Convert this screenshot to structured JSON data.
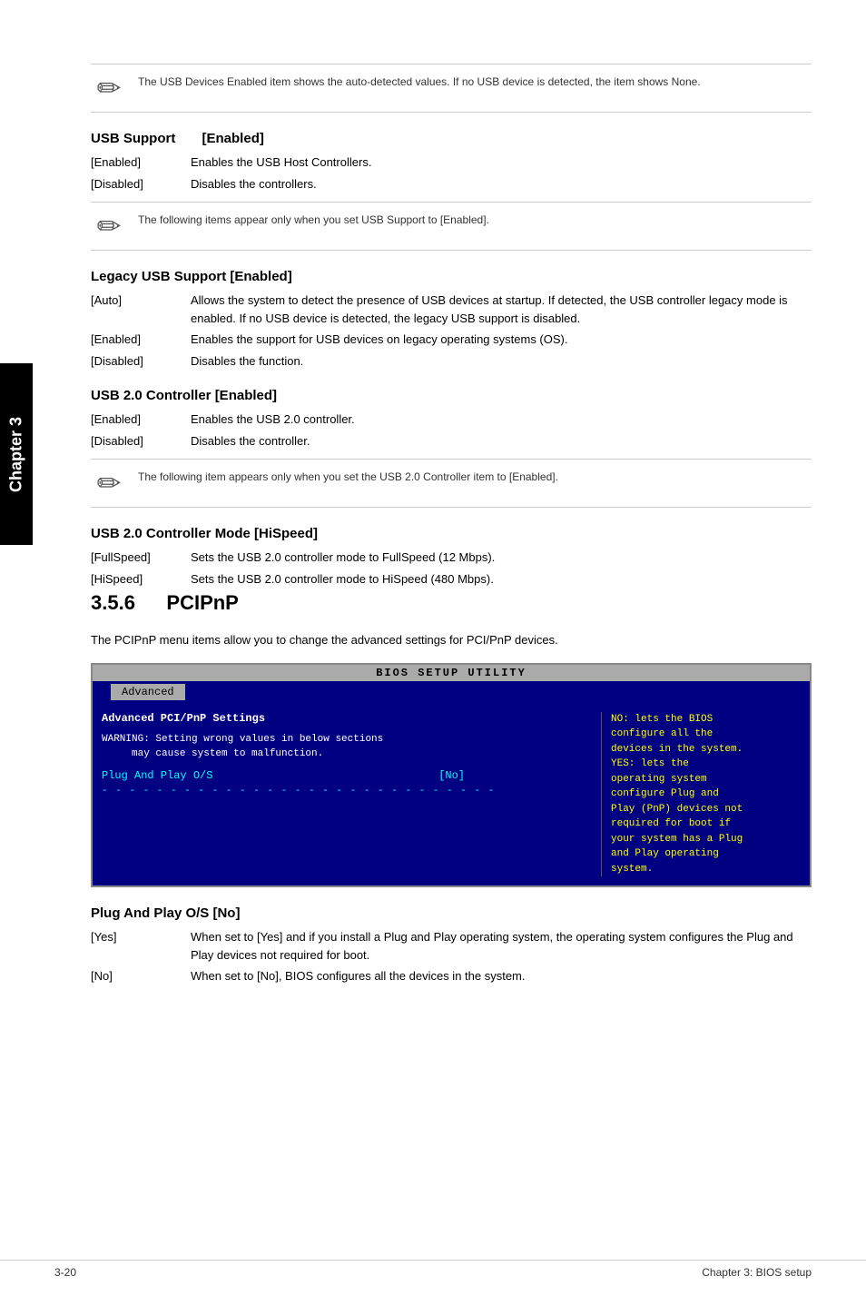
{
  "page": {
    "footer_left": "3-20",
    "footer_right": "Chapter 3: BIOS setup",
    "chapter_label": "Chapter 3"
  },
  "note1": {
    "text": "The USB Devices Enabled item shows the auto-detected values. If no USB device is detected, the item shows None."
  },
  "usb_support": {
    "heading": "USB Support",
    "value": "[Enabled]",
    "items": [
      {
        "label": "[Enabled]",
        "desc": "Enables the USB Host Controllers."
      },
      {
        "label": "[Disabled]",
        "desc": "Disables the controllers."
      }
    ]
  },
  "note2": {
    "text": "The following items appear only when you set USB Support to [Enabled]."
  },
  "legacy_usb": {
    "heading": "Legacy USB Support [Enabled]",
    "items": [
      {
        "label": "[Auto]",
        "desc": "Allows the system to detect the presence of USB devices at startup. If detected, the USB controller legacy mode is enabled. If no USB device is detected, the legacy USB support is disabled."
      },
      {
        "label": "[Enabled]",
        "desc": "Enables the support for USB devices on legacy operating systems (OS)."
      },
      {
        "label": "[Disabled]",
        "desc": "Disables the function."
      }
    ]
  },
  "usb20_controller": {
    "heading": "USB 2.0 Controller [Enabled]",
    "items": [
      {
        "label": "[Enabled]",
        "desc": "Enables the USB 2.0 controller."
      },
      {
        "label": "[Disabled]",
        "desc": "Disables the controller."
      }
    ]
  },
  "note3": {
    "text": "The following item appears only when you set the USB 2.0 Controller item to [Enabled]."
  },
  "usb20_mode": {
    "heading": "USB 2.0 Controller Mode [HiSpeed]",
    "items": [
      {
        "label": "[FullSpeed]",
        "desc": "Sets the USB 2.0 controller mode to FullSpeed (12 Mbps)."
      },
      {
        "label": "[HiSpeed]",
        "desc": "Sets the USB 2.0 controller mode to HiSpeed (480 Mbps)."
      }
    ]
  },
  "section356": {
    "number": "3.5.6",
    "title": "PCIPnP",
    "intro": "The PCIPnP menu items allow you to change the advanced settings for PCI/PnP devices."
  },
  "bios": {
    "title": "BIOS SETUP UTILITY",
    "nav_items": [
      "Advanced"
    ],
    "section_title": "Advanced PCI/PnP Settings",
    "warning": "WARNING: Setting wrong values in below sections\n     may cause system to malfunction.",
    "settings": [
      {
        "name": "Plug And Play O/S",
        "value": "[No]"
      }
    ],
    "help_text": "NO: lets the BIOS configure all the devices in the system.\nYES: lets the operating system configure Plug and Play (PnP) devices not required for boot if your system has a Plug and Play operating system.",
    "dashes": "- - - - - - - - - - - - - - - - - - - - - - - - - - - - - - - -"
  },
  "plug_play": {
    "heading": "Plug And Play O/S [No]",
    "items": [
      {
        "label": "[Yes]",
        "desc": "When set to [Yes] and if you install a Plug and Play operating system, the operating system configures the Plug and Play devices not required for boot."
      },
      {
        "label": "[No]",
        "desc": "When set to [No], BIOS configures all the devices in the system."
      }
    ]
  }
}
